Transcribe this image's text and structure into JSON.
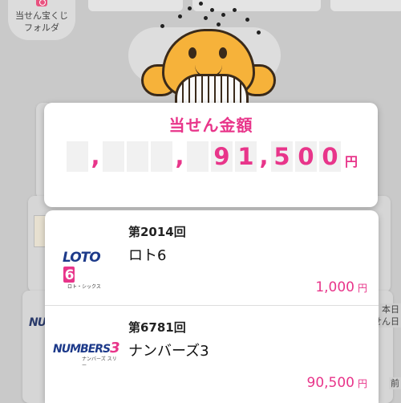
{
  "folder": {
    "label_line1": "当せん宝くじ",
    "label_line2": "フォルダ"
  },
  "backdrop": {
    "right_label_1": "本日",
    "right_label_2": "せん日",
    "right_label_3": "前",
    "numbers_logo": "NUMBE"
  },
  "prize": {
    "title": "当せん金額",
    "digits": [
      "",
      ",",
      "",
      "",
      "",
      ",",
      "",
      "9",
      "1",
      ",",
      "5",
      "0",
      "0"
    ],
    "unit": "円"
  },
  "results": [
    {
      "round": "第2014回",
      "game": "ロト6",
      "logo_text": "LOTO",
      "logo_number": "6",
      "logo_sub": "ロト・シックス",
      "amount": "1,000",
      "unit": "円"
    },
    {
      "round": "第6781回",
      "game": "ナンバーズ3",
      "logo_text": "NUMBERS",
      "logo_number": "3",
      "logo_sub": "ナンバーズ スリー",
      "amount": "90,500",
      "unit": "円"
    }
  ],
  "colors": {
    "accent": "#e8358a",
    "logo_blue": "#1d3a8a",
    "mascot": "#f6b23a"
  }
}
